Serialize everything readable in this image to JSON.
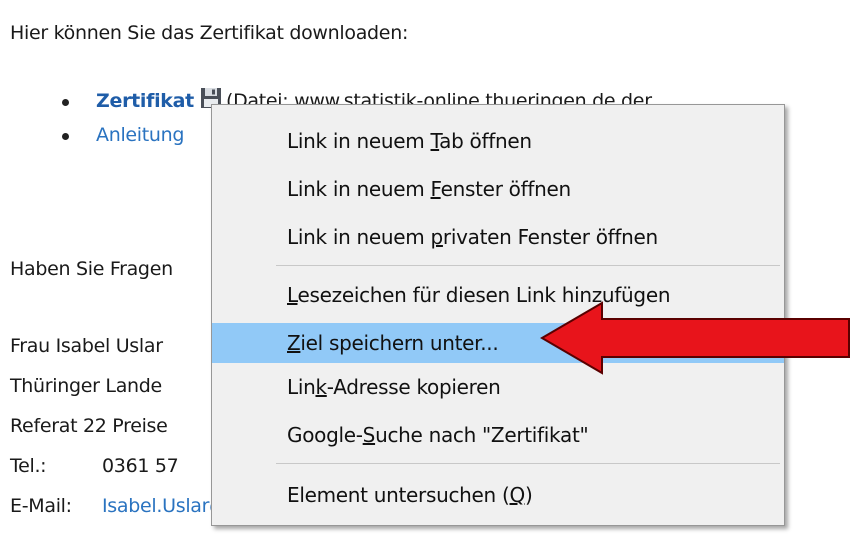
{
  "intro": "Hier können Sie das Zertifikat downloaden:",
  "links": {
    "zertifikat": "Zertifikat",
    "file_note": "(Datei: www.statistik-online.thueringen.de der",
    "anleitung": "Anleitung"
  },
  "questions": "Haben Sie Fragen",
  "contact": {
    "name": "Frau Isabel Uslar",
    "office": "Thüringer Lande",
    "referat": "Referat 22 Preise",
    "tel_label": "Tel.:",
    "tel_value": "0361 57",
    "email_label": "E-Mail:",
    "email_value": "Isabel.Uslar@statistik.thueringen.de"
  },
  "context_menu": {
    "open_tab": {
      "pre": "Link in neuem ",
      "key": "T",
      "post": "ab öffnen"
    },
    "open_window": {
      "pre": "Link in neuem ",
      "key": "F",
      "post": "enster öffnen"
    },
    "open_private": {
      "pre": "Link in neuem ",
      "key": "p",
      "post": "rivaten Fenster öffnen"
    },
    "bookmark": {
      "pre": "",
      "key": "L",
      "post": "esezeichen für diesen Link hinzufügen"
    },
    "save_target": {
      "pre": "",
      "key": "Z",
      "post": "iel speichern unter..."
    },
    "copy_link": {
      "pre": "Lin",
      "key": "k",
      "post": "-Adresse kopieren"
    },
    "google": {
      "pre": "Google-",
      "key": "S",
      "post": "uche nach \"Zertifikat\""
    },
    "inspect": {
      "pre": "Element untersuchen (",
      "key": "Q",
      "post": ")"
    },
    "highlight_color": "#91c9f7"
  },
  "arrow_color": "#e8141b"
}
